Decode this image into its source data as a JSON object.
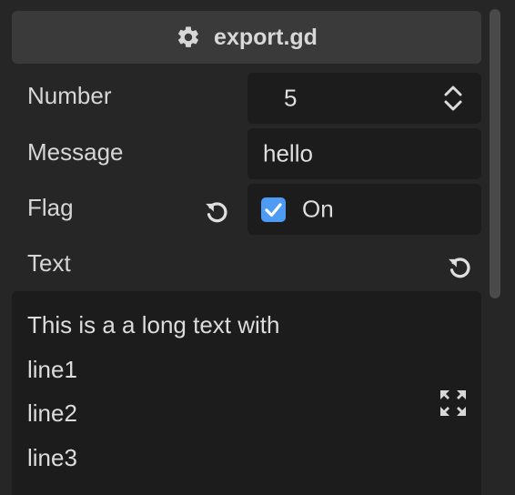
{
  "header": {
    "title": "export.gd",
    "icon": "gear-icon"
  },
  "properties": [
    {
      "label": "Number",
      "value": "5",
      "control": "spinbox"
    },
    {
      "label": "Message",
      "value": "hello",
      "control": "line-edit"
    },
    {
      "label": "Flag",
      "value": "On",
      "control": "checkbox",
      "checked": true
    },
    {
      "label": "Text",
      "control": "text-edit"
    }
  ],
  "text_edit": {
    "lines": [
      "This is a a long text with",
      "line1",
      "line2",
      "line3"
    ]
  },
  "colors": {
    "accent": "#4d9bf5",
    "panel_bg": "#262626",
    "field_bg": "#1c1c1c",
    "header_bg": "#3a3a3a"
  }
}
